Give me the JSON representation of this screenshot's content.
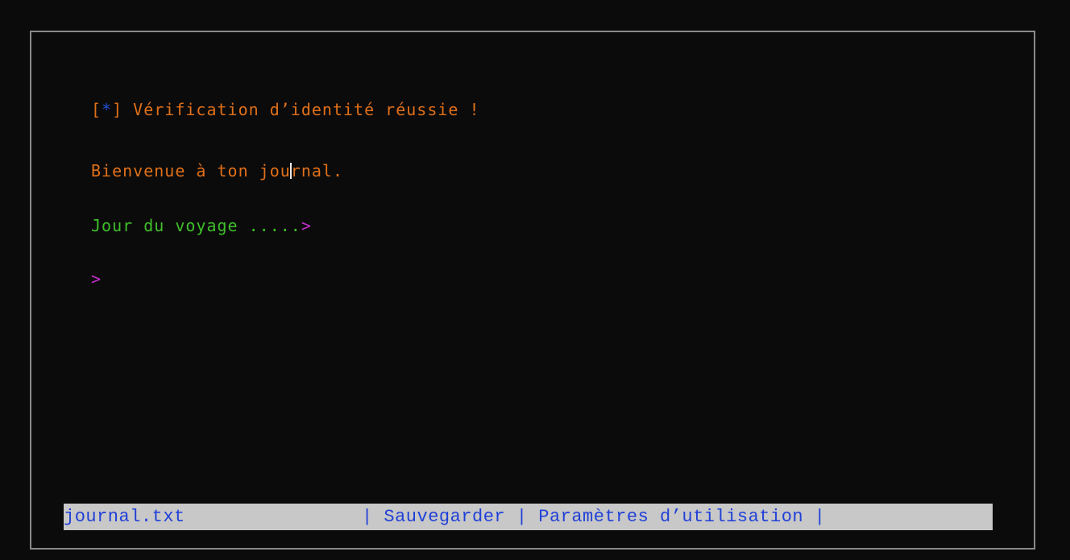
{
  "terminal": {
    "line1_open": "[",
    "line1_star": "*",
    "line1_close": "]",
    "line1_text": " Vérification d’identité réussie !",
    "line2_before": "Bienvenue à ton jou",
    "line2_after": "rnal.",
    "line3_text": "Jour du voyage .....",
    "line3_prompt": ">",
    "line4_prompt": ">"
  },
  "statusbar": {
    "filename": "journal.txt",
    "separator1": "| ",
    "save": "Sauvegarder",
    "separator2": " | ",
    "settings": "Paramètres d’utilisation",
    "separator3": " |"
  },
  "colors": {
    "background": "#0b0b0b",
    "orange": "#e0701a",
    "blue": "#1f4fd6",
    "green": "#3fbf2a",
    "magenta": "#c12fc9",
    "statusbar_bg": "#c8c8c8",
    "statusbar_text": "#2040d8"
  }
}
